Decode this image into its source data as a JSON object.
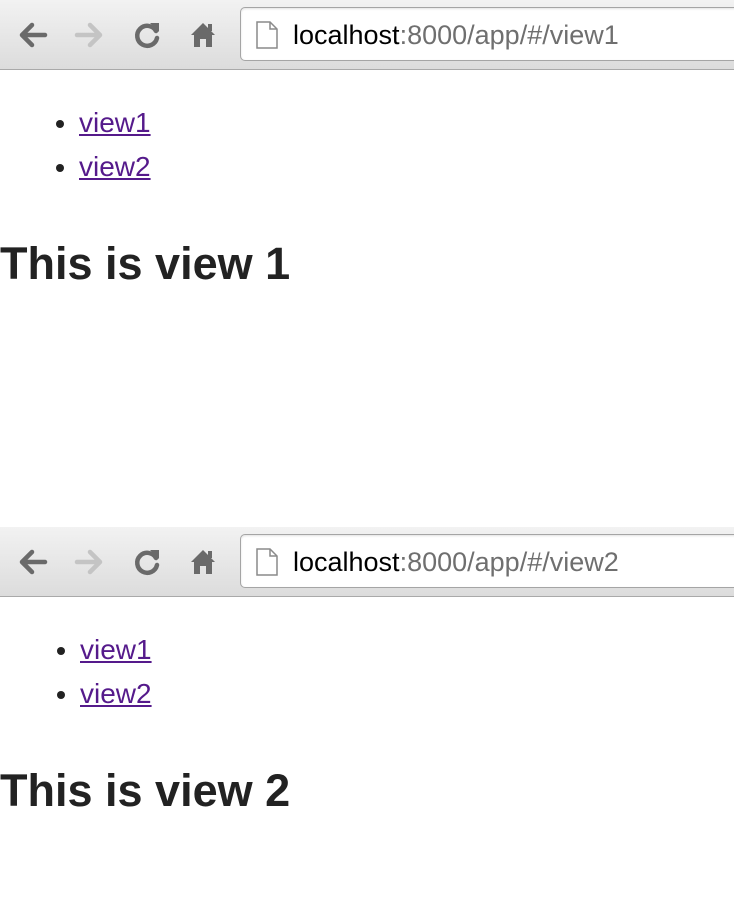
{
  "screenshots": [
    {
      "browser": {
        "url_host": "localhost",
        "url_path": ":8000/app/#/view1",
        "back_icon": "arrow-left-icon",
        "forward_icon": "arrow-right-icon",
        "reload_icon": "reload-icon",
        "home_icon": "home-icon",
        "page_icon": "document-icon"
      },
      "nav_links": [
        "view1",
        "view2"
      ],
      "heading": "This is view 1"
    },
    {
      "browser": {
        "url_host": "localhost",
        "url_path": ":8000/app/#/view2",
        "back_icon": "arrow-left-icon",
        "forward_icon": "arrow-right-icon",
        "reload_icon": "reload-icon",
        "home_icon": "home-icon",
        "page_icon": "document-icon"
      },
      "nav_links": [
        "view1",
        "view2"
      ],
      "heading": "This is view 2"
    }
  ],
  "colors": {
    "link_visited": "#551a8b",
    "heading_text": "#222222",
    "url_dim": "#6f6f6f",
    "toolbar_top": "#f2f2f2",
    "toolbar_bottom": "#dcdcdc"
  }
}
